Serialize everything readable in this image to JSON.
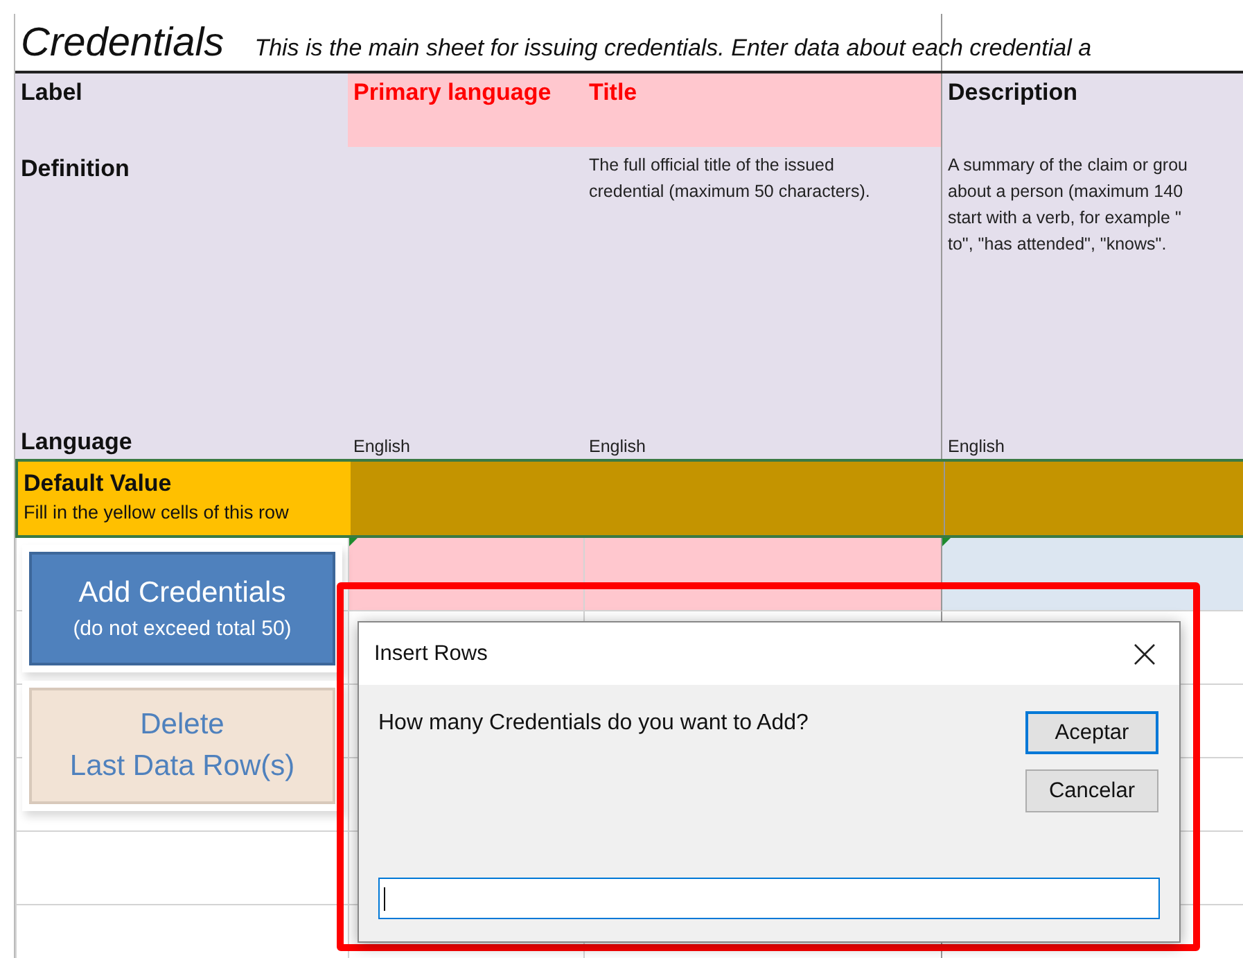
{
  "sheet": {
    "title": "Credentials",
    "subtitle": "This is the main sheet for issuing credentials. Enter data about each credential a"
  },
  "row_headers": {
    "label": "Label",
    "definition": "Definition",
    "language": "Language"
  },
  "columns": [
    {
      "label": "Primary language",
      "required": true,
      "language": "English"
    },
    {
      "label": "Title",
      "required": true,
      "definition_lines": [
        "The full official title of the issued",
        "credential (maximum 50 characters)."
      ],
      "language": "English"
    },
    {
      "label": "Description",
      "required": false,
      "definition_lines": [
        "A summary of the claim or grou",
        "about a person (maximum 140",
        "start with a verb, for example \"",
        "to\", \"has attended\", \"knows\"."
      ],
      "language": "English"
    }
  ],
  "default_row": {
    "title": "Default Value",
    "hint": "Fill in the yellow cells of this row"
  },
  "buttons": [
    {
      "kind": "primary",
      "lines": [
        "Add Credentials",
        "(do not exceed total 50)"
      ]
    },
    {
      "kind": "secondary",
      "lines": [
        "Delete",
        "Last Data Row(s)"
      ]
    }
  ],
  "dialog": {
    "title": "Insert Rows",
    "prompt": "How many Credentials do you want to Add?",
    "buttons": [
      {
        "label": "Aceptar",
        "default": true
      },
      {
        "label": "Cancelar",
        "default": false
      }
    ]
  }
}
